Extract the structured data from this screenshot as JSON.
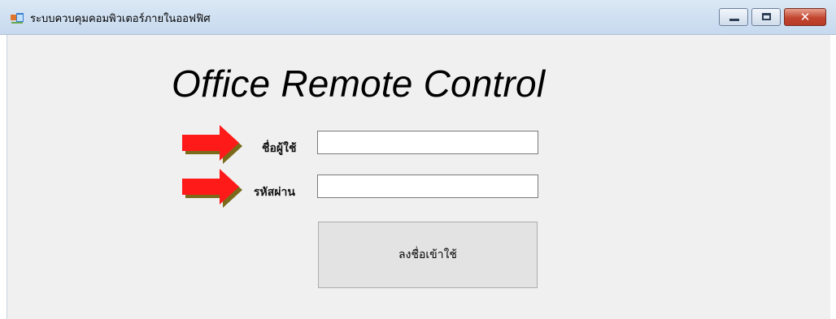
{
  "window": {
    "title": "ระบบควบคุมคอมพิวเตอร์ภายในออฟฟิศ",
    "controls": [
      "minimize",
      "maximize",
      "close"
    ],
    "close_glyph": "✕"
  },
  "form": {
    "heading": "Office Remote Control",
    "username_label": "ชื่อผู้ใช้",
    "username_value": "",
    "password_label": "รหัสผ่าน",
    "password_value": "",
    "login_button": "ลงชื่อเข้าใช้"
  },
  "icons": {
    "app": "app-window-icon",
    "pointer": "red-arrow-icon"
  },
  "colors": {
    "arrow_red": "#ff1a1a",
    "arrow_shadow": "#7a6a1a",
    "client_bg": "#f0f0f0",
    "close_red": "#c2452f"
  }
}
